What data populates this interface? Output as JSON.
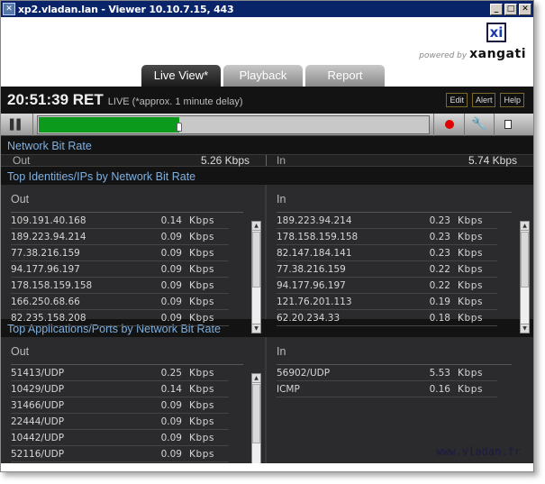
{
  "window": {
    "title": "xp2.vladan.lan - Viewer 10.10.7.15, 443",
    "controls": [
      "minimize",
      "maximize",
      "close"
    ]
  },
  "logo": {
    "mark": "xi",
    "powered_by": "powered by",
    "brand": "xangati"
  },
  "tabs": [
    {
      "label": "Live View*",
      "active": true
    },
    {
      "label": "Playback",
      "active": false
    },
    {
      "label": "Report",
      "active": false
    }
  ],
  "status": {
    "clock": "20:51:39 RET",
    "live_text": "LIVE (*approx. 1 minute  delay)",
    "buttons": [
      "Edit",
      "Alert",
      "Help"
    ]
  },
  "toolbar": {
    "pause_icon": "pause-icon",
    "timeline_progress_percent": 36,
    "record_icon": "record-icon",
    "wrench_icon": "wrench-icon",
    "document_icon": "document-icon"
  },
  "network_bit_rate": {
    "title": "Network Bit Rate",
    "out_label": "Out",
    "out_value": "5.26 Kbps",
    "in_label": "In",
    "in_value": "5.74 Kbps"
  },
  "top_identities": {
    "title": "Top Identities/IPs by Network Bit Rate",
    "out": {
      "header": "Out",
      "rows": [
        {
          "name": "109.191.40.168",
          "value": "0.14",
          "unit": "Kbps"
        },
        {
          "name": "189.223.94.214",
          "value": "0.09",
          "unit": "Kbps"
        },
        {
          "name": "77.38.216.159",
          "value": "0.09",
          "unit": "Kbps"
        },
        {
          "name": "94.177.96.197",
          "value": "0.09",
          "unit": "Kbps"
        },
        {
          "name": "178.158.159.158",
          "value": "0.09",
          "unit": "Kbps"
        },
        {
          "name": "166.250.68.66",
          "value": "0.09",
          "unit": "Kbps"
        },
        {
          "name": "82.235.158.208",
          "value": "0.09",
          "unit": "Kbps"
        }
      ]
    },
    "in": {
      "header": "In",
      "rows": [
        {
          "name": "189.223.94.214",
          "value": "0.23",
          "unit": "Kbps"
        },
        {
          "name": "178.158.159.158",
          "value": "0.23",
          "unit": "Kbps"
        },
        {
          "name": "82.147.184.141",
          "value": "0.23",
          "unit": "Kbps"
        },
        {
          "name": "77.38.216.159",
          "value": "0.22",
          "unit": "Kbps"
        },
        {
          "name": "94.177.96.197",
          "value": "0.22",
          "unit": "Kbps"
        },
        {
          "name": "121.76.201.113",
          "value": "0.19",
          "unit": "Kbps"
        },
        {
          "name": "62.20.234.33",
          "value": "0.18",
          "unit": "Kbps"
        }
      ]
    }
  },
  "top_applications": {
    "title": "Top Applications/Ports by Network Bit Rate",
    "out": {
      "header": "Out",
      "rows": [
        {
          "name": "51413/UDP",
          "value": "0.25",
          "unit": "Kbps"
        },
        {
          "name": "10429/UDP",
          "value": "0.14",
          "unit": "Kbps"
        },
        {
          "name": "31466/UDP",
          "value": "0.09",
          "unit": "Kbps"
        },
        {
          "name": "22444/UDP",
          "value": "0.09",
          "unit": "Kbps"
        },
        {
          "name": "10442/UDP",
          "value": "0.09",
          "unit": "Kbps"
        },
        {
          "name": "52116/UDP",
          "value": "0.09",
          "unit": "Kbps"
        }
      ]
    },
    "in": {
      "header": "In",
      "rows": [
        {
          "name": "56902/UDP",
          "value": "5.53",
          "unit": "Kbps"
        },
        {
          "name": "ICMP",
          "value": "0.16",
          "unit": "Kbps"
        }
      ]
    }
  },
  "watermark": "www.vladan.fr"
}
